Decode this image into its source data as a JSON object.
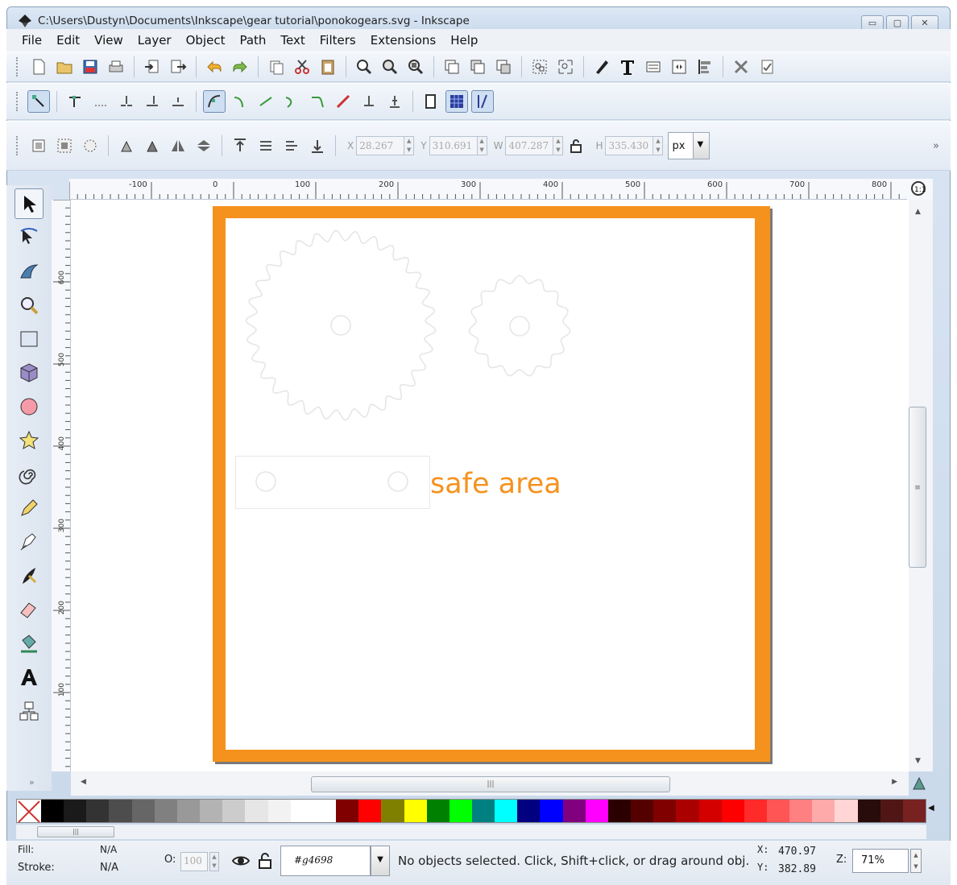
{
  "window": {
    "title": "C:\\Users\\Dustyn\\Documents\\Inkscape\\gear tutorial\\ponokogears.svg - Inkscape",
    "buttons": [
      "▭",
      "▢",
      "✕"
    ]
  },
  "menu": [
    "File",
    "Edit",
    "View",
    "Layer",
    "Object",
    "Path",
    "Text",
    "Filters",
    "Extensions",
    "Help"
  ],
  "select_toolbar": {
    "x_label": "X",
    "x_value": "28.267",
    "y_label": "Y",
    "y_value": "310.691",
    "w_label": "W",
    "w_value": "407.287",
    "h_label": "H",
    "h_value": "335.430",
    "unit": "px",
    "more": "»"
  },
  "rulers": {
    "h_labels": [
      "-100",
      "0",
      "100",
      "200",
      "300",
      "400",
      "500",
      "600",
      "700",
      "800"
    ],
    "v_labels": [
      "600",
      "500",
      "400",
      "300",
      "200",
      "100"
    ]
  },
  "canvas": {
    "label": "safe area",
    "accent": "#f5921e"
  },
  "palette": {
    "colors": [
      "#000000",
      "#1a1a1a",
      "#333333",
      "#4d4d4d",
      "#666666",
      "#808080",
      "#999999",
      "#b3b3b3",
      "#cccccc",
      "#e6e6e6",
      "#f2f2f2",
      "#ffffff",
      "#ffffff",
      "#800000",
      "#ff0000",
      "#808000",
      "#ffff00",
      "#008000",
      "#00ff00",
      "#008080",
      "#00ffff",
      "#000080",
      "#0000ff",
      "#800080",
      "#ff00ff",
      "#2b0000",
      "#550000",
      "#800000",
      "#aa0000",
      "#d40000",
      "#ff0000",
      "#ff2a2a",
      "#ff5555",
      "#ff8080",
      "#ffaaaa",
      "#ffd5d5",
      "#280b0b",
      "#501616",
      "#782121"
    ]
  },
  "status": {
    "fill_label": "Fill:",
    "fill_value": "N/A",
    "stroke_label": "Stroke:",
    "stroke_value": "N/A",
    "opacity_label": "O:",
    "opacity_value": "100",
    "layer": "#g4698",
    "message": "No objects selected. Click, Shift+click, or drag around obj.",
    "x_label": "X:",
    "x_value": "470.97",
    "y_label": "Y:",
    "y_value": "382.89",
    "zoom_label": "Z:",
    "zoom_value": "71%"
  }
}
